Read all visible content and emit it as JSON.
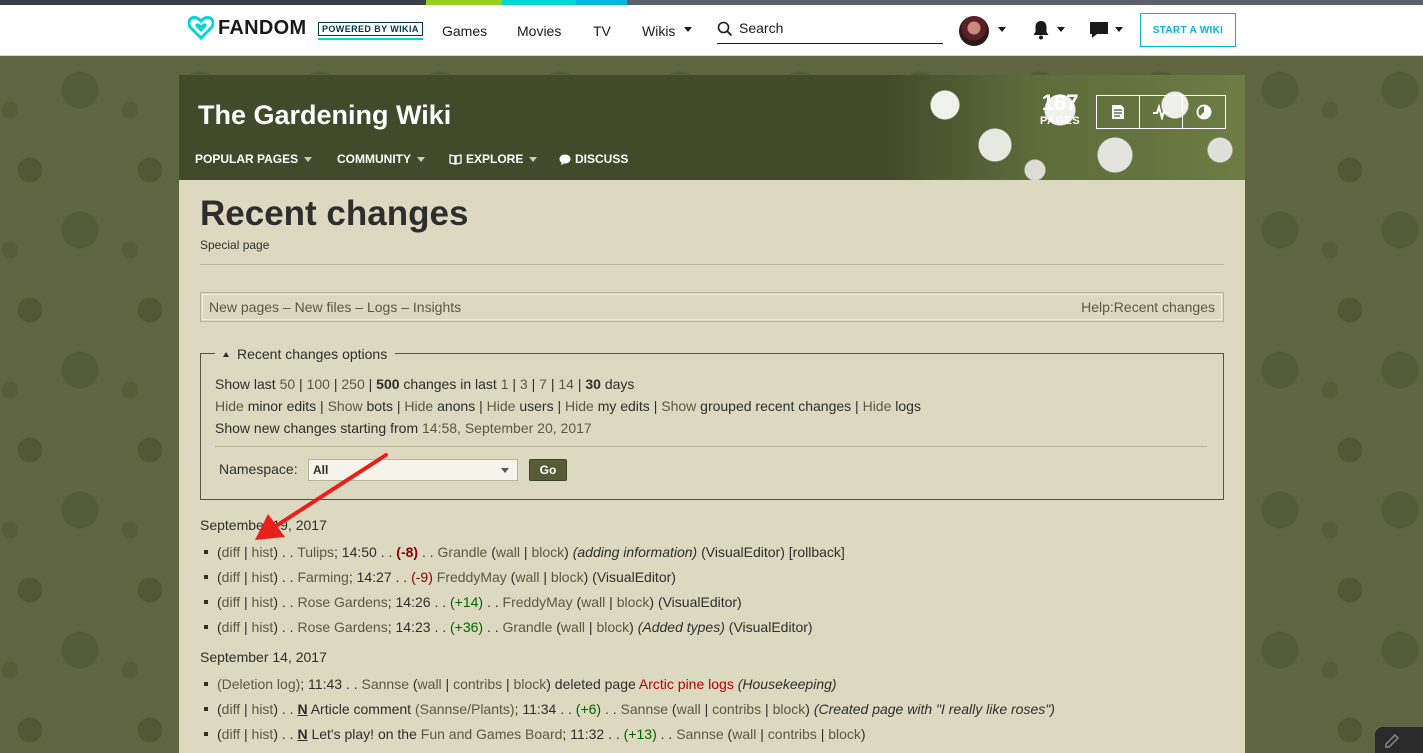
{
  "colors": {
    "accent": "#00b7e0",
    "brand_green": "#565d36",
    "positive": "#006400",
    "negative": "#8b0000"
  },
  "global_nav": {
    "logo": "FANDOM",
    "powered_by": "POWERED BY WIKIA",
    "links": [
      "Games",
      "Movies",
      "TV",
      "Wikis"
    ],
    "search_placeholder": "Search",
    "start_wiki": "START A WIKI",
    "icons": [
      "avatar",
      "bell-icon",
      "chat-icon"
    ]
  },
  "wiki": {
    "title": "The Gardening Wiki",
    "nav": [
      "POPULAR PAGES",
      "COMMUNITY",
      "EXPLORE",
      "DISCUSS"
    ],
    "page_count": "167",
    "page_count_label": "PAGES"
  },
  "page": {
    "title": "Recent changes",
    "subtitle": "Special page",
    "top_links": "New pages – New files – Logs – Insights",
    "help_link": "Help:Recent changes"
  },
  "options": {
    "legend": "Recent changes options",
    "show_last": "Show last",
    "counts": [
      "50",
      "100",
      "250"
    ],
    "count_selected": "500",
    "changes_in_last": "changes in last",
    "days": [
      "1",
      "3",
      "7",
      "14"
    ],
    "days_selected": "30",
    "days_label": "days",
    "hide_line": {
      "minor_a": "Hide",
      "minor_b": "minor edits",
      "bots_a": "Show",
      "bots_b": "bots",
      "anons_a": "Hide",
      "anons_b": "anons",
      "users_a": "Hide",
      "users_b": "users",
      "my_a": "Hide",
      "my_b": "my edits",
      "grouped_a": "Show",
      "grouped_b": "grouped recent changes",
      "logs_a": "Hide",
      "logs_b": "logs"
    },
    "new_changes_text": "Show new changes starting from",
    "new_changes_link": "14:58, September 20, 2017",
    "namespace_label": "Namespace:",
    "namespace_value": "All",
    "go": "Go"
  },
  "groups": [
    {
      "date": "September 19, 2017",
      "rows": [
        {
          "page": "Tulips",
          "time": "14:50",
          "delta": "(-8)",
          "user": "Grandle",
          "summary": "(adding information)",
          "tag": "(VisualEditor)",
          "extra": "[rollback]"
        },
        {
          "page": "Farming",
          "time": "14:27",
          "delta": "(-9)",
          "user": "FreddyMay",
          "summary": "",
          "tag": "(VisualEditor)",
          "extra": ""
        },
        {
          "page": "Rose Gardens",
          "time": "14:26",
          "delta": "(+14)",
          "user": "FreddyMay",
          "summary": "",
          "tag": "(VisualEditor)",
          "extra": ""
        },
        {
          "page": "Rose Gardens",
          "time": "14:23",
          "delta": "(+36)",
          "user": "Grandle",
          "summary": "(Added types)",
          "tag": "(VisualEditor)",
          "extra": ""
        }
      ]
    },
    {
      "date": "September 14, 2017",
      "rows": [
        {
          "log": "(Deletion log)",
          "time": "11:43",
          "user": "Sannse",
          "action": "deleted page",
          "target": "Arctic pine logs",
          "summary": "(Housekeeping)"
        },
        {
          "flag": "N",
          "page_prefix": "Article comment",
          "page": "(Sannse/Plants)",
          "time": "11:34",
          "delta": "(+6)",
          "user": "Sannse",
          "summary": "(Created page with \"I really like roses\")"
        },
        {
          "flag": "N",
          "page_prefix": "Let's play! on the",
          "page": "Fun and Games Board",
          "time": "11:32",
          "delta": "(+13)",
          "user": "Sannse"
        }
      ]
    }
  ],
  "common": {
    "diff": "diff",
    "hist": "hist",
    "wall": "wall",
    "contribs": "contribs",
    "block": "block"
  }
}
